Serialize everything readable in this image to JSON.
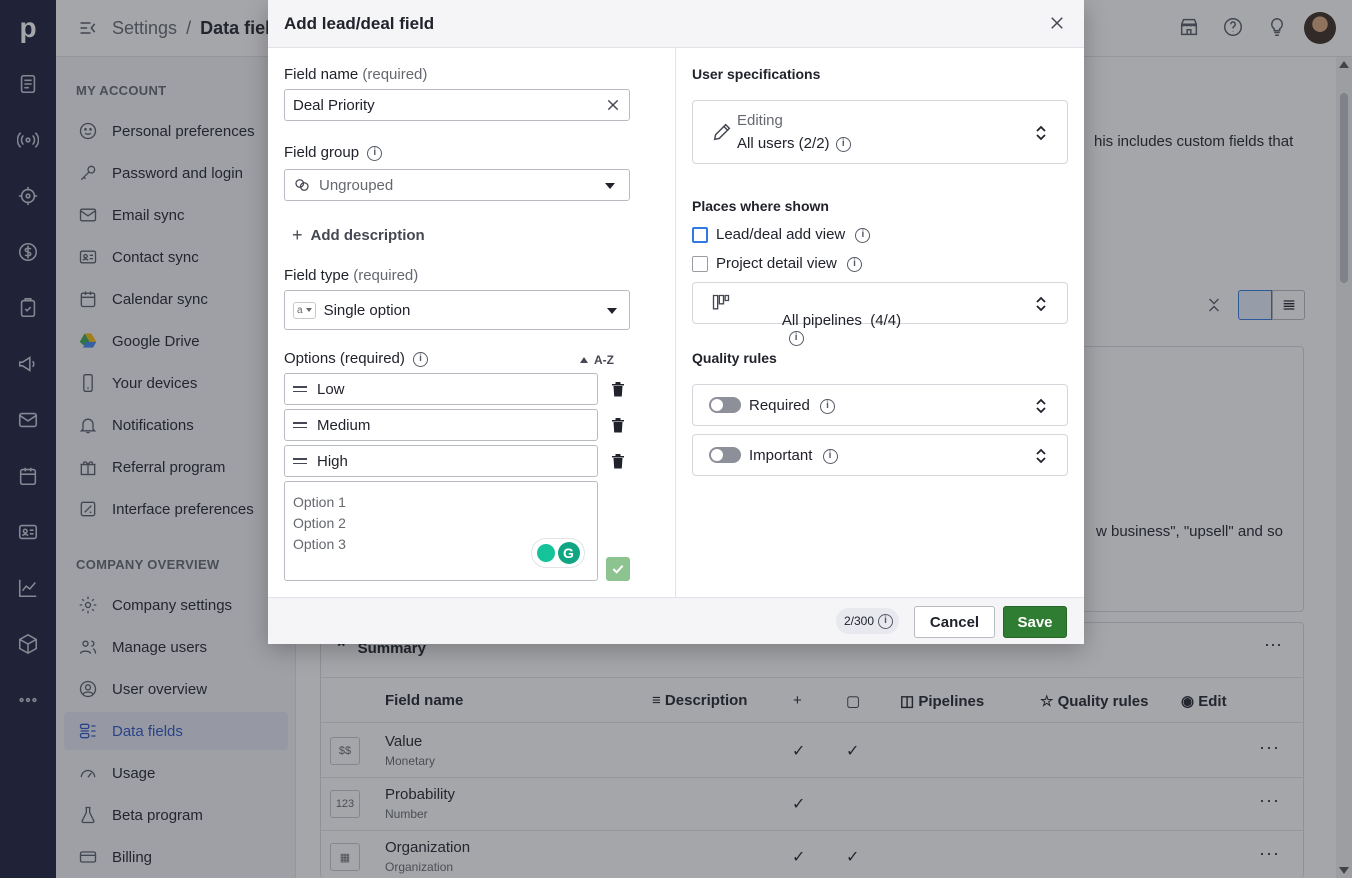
{
  "breadcrumb": {
    "parent": "Settings",
    "separator": "/",
    "current": "Data fields"
  },
  "sidebar": {
    "my_account_label": "MY ACCOUNT",
    "company_label": "COMPANY OVERVIEW",
    "items": [
      {
        "label": "Personal preferences",
        "icon": "smiley-icon"
      },
      {
        "label": "Password and login",
        "icon": "key-icon"
      },
      {
        "label": "Email sync",
        "icon": "mail-icon"
      },
      {
        "label": "Contact sync",
        "icon": "contact-card-icon"
      },
      {
        "label": "Calendar sync",
        "icon": "calendar-icon"
      },
      {
        "label": "Google Drive",
        "icon": "google-drive-icon"
      },
      {
        "label": "Your devices",
        "icon": "phone-icon"
      },
      {
        "label": "Notifications",
        "icon": "bell-icon"
      },
      {
        "label": "Referral program",
        "icon": "gift-icon"
      },
      {
        "label": "Interface preferences",
        "icon": "interface-icon"
      },
      {
        "label": "Company settings",
        "icon": "gear-icon"
      },
      {
        "label": "Manage users",
        "icon": "users-icon"
      },
      {
        "label": "User overview",
        "icon": "user-circle-icon"
      },
      {
        "label": "Data fields",
        "icon": "data-fields-icon",
        "active": true
      },
      {
        "label": "Usage",
        "icon": "gauge-icon"
      },
      {
        "label": "Beta program",
        "icon": "flask-icon"
      },
      {
        "label": "Billing",
        "icon": "card-icon"
      }
    ]
  },
  "background": {
    "intro_fragment": "his includes custom fields that",
    "mid_fragment": "w business\", \"upsell\" and so",
    "section_title": "Summary",
    "columns": [
      "Field name",
      "Description",
      "Pipelines",
      "Quality rules",
      "Edit"
    ],
    "rows": [
      {
        "icon": "$$",
        "name": "Value",
        "type": "Monetary",
        "col1": "✓",
        "col2": "✓"
      },
      {
        "icon": "123",
        "name": "Probability",
        "type": "Number",
        "col1": "✓",
        "col2": ""
      },
      {
        "icon": "▦",
        "name": "Organization",
        "type": "Organization",
        "col1": "✓",
        "col2": "✓"
      }
    ]
  },
  "modal": {
    "title": "Add lead/deal field",
    "field_name_label": "Field name",
    "required_suffix": "(required)",
    "field_name_value": "Deal Priority",
    "field_group_label": "Field group",
    "field_group_value": "Ungrouped",
    "add_description": "Add description",
    "field_type_label": "Field type",
    "field_type_value": "Single option",
    "options_label": "Options (required)",
    "sort_label": "A-Z",
    "options": [
      "Low",
      "Medium",
      "High"
    ],
    "new_options_placeholder": [
      "Option 1",
      "Option 2",
      "Option 3"
    ],
    "right": {
      "user_spec_title": "User specifications",
      "editing_label": "Editing",
      "editing_value": "All users (2/2)",
      "places_title": "Places where shown",
      "place_add_view": "Lead/deal add view",
      "place_project_view": "Project detail view",
      "pipelines_value": "All pipelines  (4/4)",
      "quality_title": "Quality rules",
      "required_label": "Required",
      "important_label": "Important"
    },
    "footer": {
      "counter": "2/300",
      "cancel": "Cancel",
      "save": "Save"
    }
  }
}
